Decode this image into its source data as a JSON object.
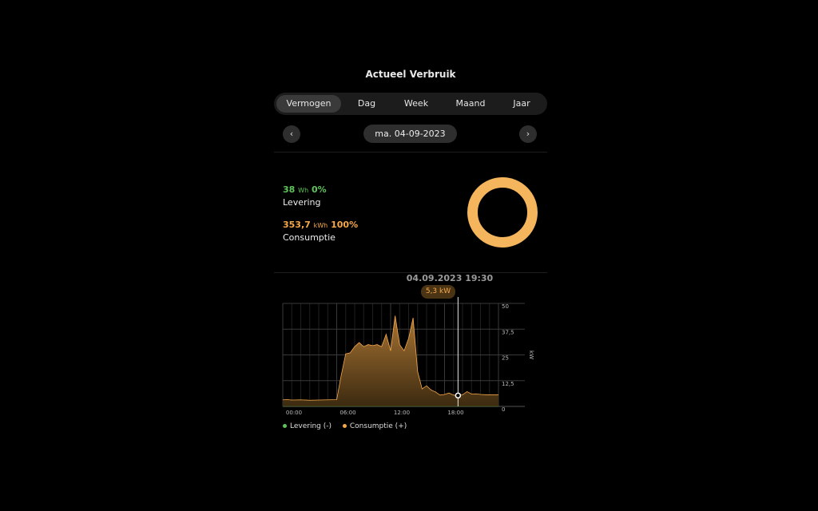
{
  "header": {
    "title": "Actueel Verbruik"
  },
  "tabs": [
    {
      "label": "Vermogen",
      "active": true
    },
    {
      "label": "Dag",
      "active": false
    },
    {
      "label": "Week",
      "active": false
    },
    {
      "label": "Maand",
      "active": false
    },
    {
      "label": "Jaar",
      "active": false
    }
  ],
  "date_nav": {
    "prev_icon": "chevron-left-icon",
    "next_icon": "chevron-right-icon",
    "prev": "‹",
    "next": "›",
    "date": "ma. 04-09-2023"
  },
  "summary": {
    "levering": {
      "value": "38",
      "unit": "Wh",
      "percent": "0%",
      "label": "Levering",
      "color": "#5ec45a"
    },
    "consumptie": {
      "value": "353,7",
      "unit": "kWh",
      "percent": "100%",
      "label": "Consumptie",
      "color": "#f5a84a"
    }
  },
  "tooltip": {
    "date": "04.09.2023 19:30",
    "value": "5,3 kW"
  },
  "legend": [
    {
      "label": "Levering (-)",
      "color": "#5ec45a"
    },
    {
      "label": "Consumptie (+)",
      "color": "#f5a84a"
    }
  ],
  "chart_data": {
    "type": "area",
    "ylabel": "kW",
    "ylim": [
      0,
      50
    ],
    "y_ticks": [
      "50",
      "37,5",
      "25",
      "12,5",
      "0"
    ],
    "x_ticks": [
      "00:00",
      "06:00",
      "12:00",
      "18:00"
    ],
    "xlim_hours": [
      0,
      24
    ],
    "series": [
      {
        "name": "Consumptie (+)",
        "color": "#f5a84a",
        "x": [
          0,
          0.5,
          1,
          2,
          3,
          4,
          5,
          6,
          6.5,
          7,
          7.5,
          8,
          8.5,
          9,
          9.5,
          10,
          10.5,
          11,
          11.5,
          12,
          12.5,
          13,
          13.5,
          14,
          14.5,
          15,
          15.5,
          16,
          16.5,
          17,
          17.5,
          18,
          18.5,
          19,
          19.5,
          20,
          20.5,
          21,
          21.5,
          22,
          23,
          24
        ],
        "y": [
          3.2,
          3.3,
          3.1,
          3.2,
          3.0,
          3.1,
          3.2,
          3.3,
          15,
          25.5,
          26,
          29,
          31,
          29,
          30,
          29.5,
          30,
          29,
          35,
          27,
          44,
          30,
          27,
          33,
          43,
          17,
          8.5,
          10,
          8,
          7,
          5.5,
          5.8,
          6.5,
          5.5,
          5.3,
          5.6,
          7.2,
          6.0,
          6.1,
          5.8,
          5.6,
          5.6
        ]
      },
      {
        "name": "Levering (-)",
        "color": "#5ec45a",
        "x": [
          0,
          24
        ],
        "y": [
          0,
          0
        ]
      }
    ],
    "crosshair": {
      "x": 19.5,
      "y": 5.3
    }
  }
}
